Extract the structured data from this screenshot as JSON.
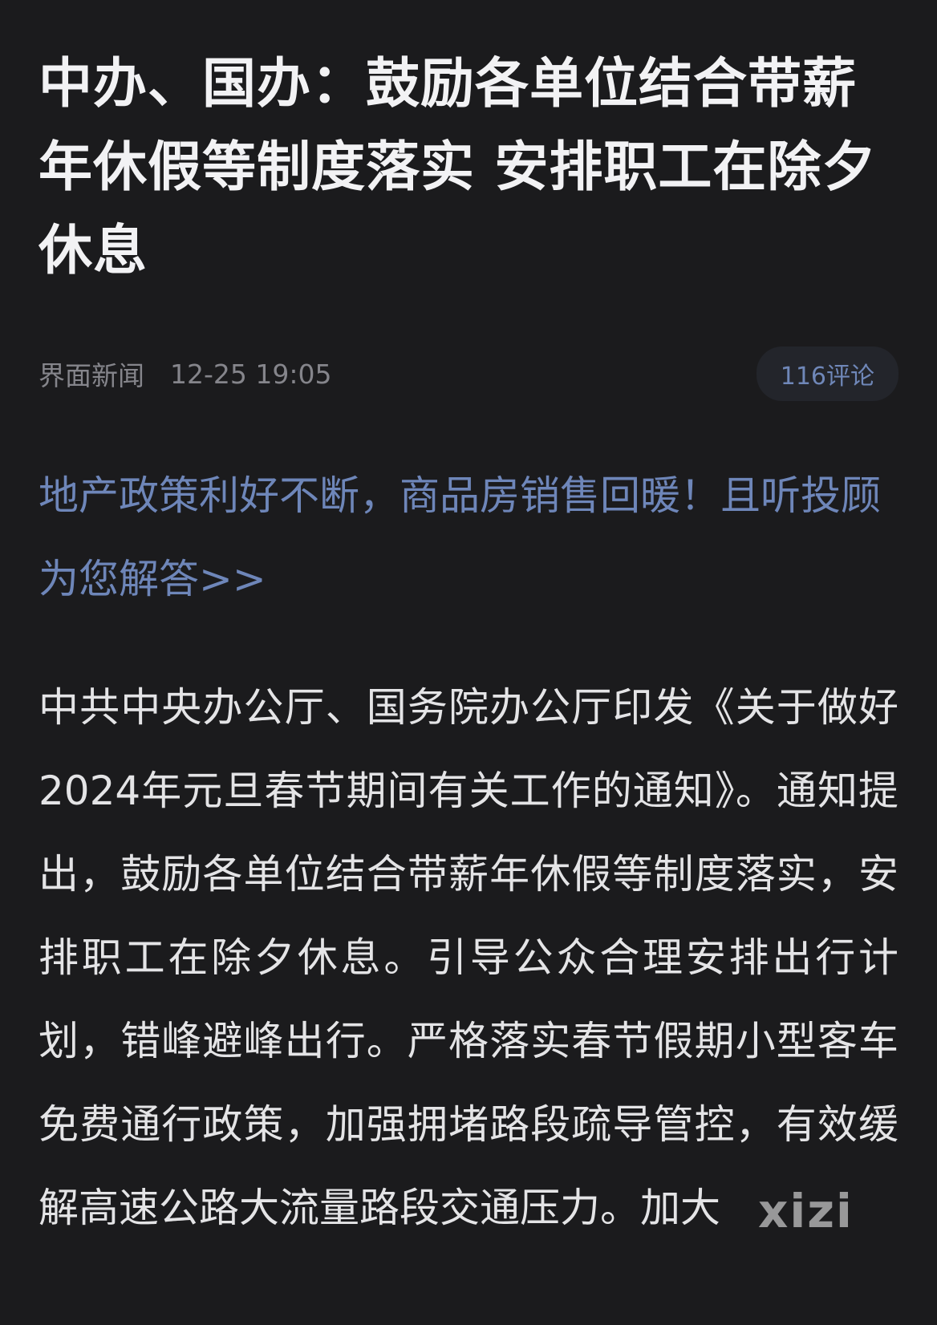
{
  "article": {
    "headline": "中办、国办：鼓励各单位结合带薪年休假等制度落实 安排职工在除夕休息",
    "source": "界面新闻",
    "timestamp": "12-25 19:05",
    "comments_label": "116评论",
    "promo_link": "地产政策利好不断，商品房销售回暖！且听投顾为您解答>>",
    "body": "中共中央办公厅、国务院办公厅印发《关于做好2024年元旦春节期间有关工作的通知》。通知提出，鼓励各单位结合带薪年休假等制度落实，安排职工在除夕休息。引导公众合理安排出行计划，错峰避峰出行。严格落实春节假期小型客车免费通行政策，加强拥堵路段疏导管控，有效缓解高速公路大流量路段交通压力。加大"
  },
  "watermark": "xizi"
}
